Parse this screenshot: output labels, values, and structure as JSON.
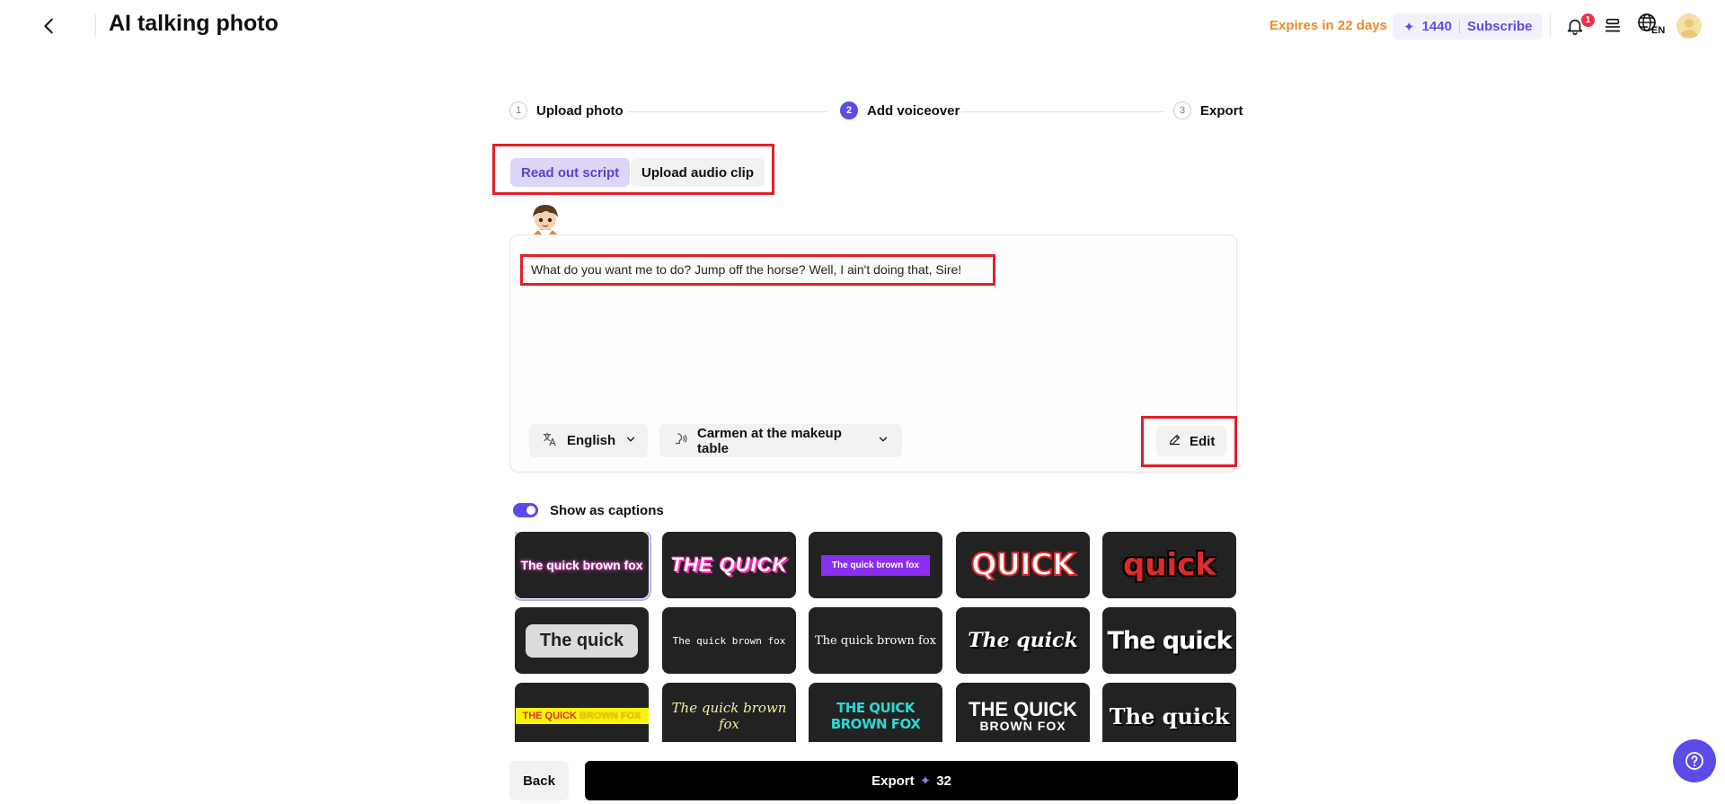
{
  "header": {
    "title": "AI talking photo",
    "expires": "Expires in 22 days",
    "credits": "1440",
    "credit_icon": "sparkle-icon",
    "subscribe": "Subscribe",
    "notification_count": "1",
    "lang_code": "EN"
  },
  "steps": [
    {
      "num": "1",
      "label": "Upload photo",
      "active": false
    },
    {
      "num": "2",
      "label": "Add voiceover",
      "active": true
    },
    {
      "num": "3",
      "label": "Export",
      "active": false
    }
  ],
  "tabs": [
    {
      "label": "Read out script",
      "active": true
    },
    {
      "label": "Upload audio clip",
      "active": false
    }
  ],
  "script": {
    "text": "What do you want me to do? Jump off the horse? Well, I ain't doing that, Sire!",
    "language": "English",
    "voice": "Carmen at the makeup table",
    "edit_label": "Edit"
  },
  "captions": {
    "toggle_label": "Show as captions",
    "toggle_on": true,
    "styles": {
      "s1": "The quick brown fox",
      "s2": "THE QUICK",
      "s3": "The quick brown fox",
      "s4": "QUICK",
      "s5": "quick",
      "s6": "The quick",
      "s7": "The quick brown fox",
      "s8": "The quick brown fox",
      "s9": "The quick",
      "s10": "The quick",
      "s11a": "THE QUICK",
      "s11b": " BROWN FOX",
      "s12": "The quick brown fox",
      "s13": "THE QUICK BROWN FOX",
      "s14a": "THE QUICK",
      "s14b": "BROWN FOX",
      "s15": "The quick"
    },
    "selected_index": 0
  },
  "footer": {
    "back": "Back",
    "export": "Export",
    "export_cost": "32"
  },
  "colors": {
    "accent": "#5b4ce8",
    "expires": "#f2892b",
    "highlight_box": "#e0202a"
  }
}
